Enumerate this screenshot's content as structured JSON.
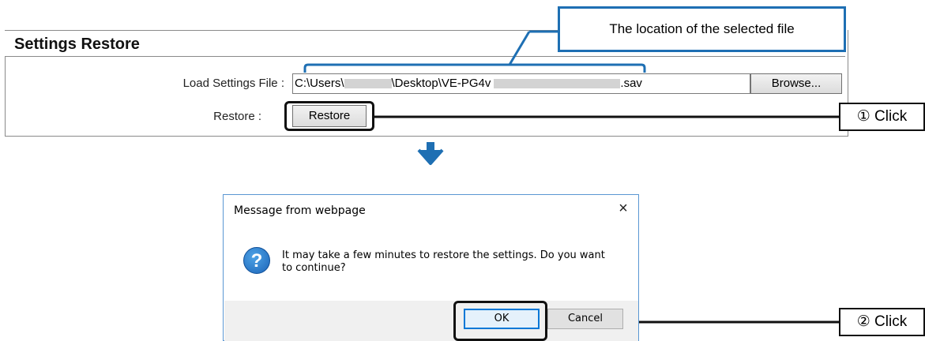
{
  "settings": {
    "title": "Settings Restore",
    "load_label": "Load Settings File :",
    "file_path_parts": [
      "C:\\Users\\",
      "\\Desktop\\VE-PG4v",
      ".sav"
    ],
    "browse_label": "Browse...",
    "restore_label": "Restore :",
    "restore_button": "Restore"
  },
  "annotations": {
    "location_note": "The location of the selected file",
    "click1": "① Click",
    "click2": "② Click",
    "accent_blue": "#1e6fb3"
  },
  "dialog": {
    "title": "Message from webpage",
    "close_glyph": "×",
    "message": "It may take a few minutes to restore the settings. Do you want to continue?",
    "icon": "question-icon",
    "ok_label": "OK",
    "cancel_label": "Cancel"
  }
}
